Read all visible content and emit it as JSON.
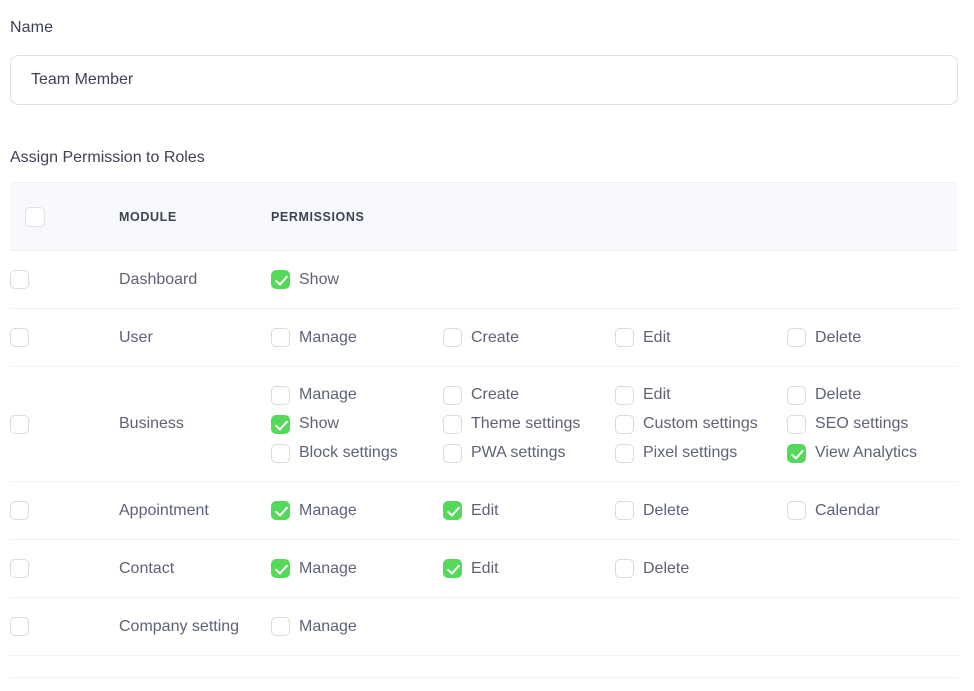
{
  "form": {
    "name_label": "Name",
    "name_value": "Team Member",
    "name_placeholder": "Name",
    "section_label": "Assign Permission to Roles"
  },
  "table": {
    "headers": {
      "select_all": "",
      "module": "MODULE",
      "permissions": "PERMISSIONS"
    },
    "select_all_checked": false,
    "rows": [
      {
        "module": "Dashboard",
        "row_checked": false,
        "permissions": [
          {
            "label": "Show",
            "checked": true
          }
        ]
      },
      {
        "module": "User",
        "row_checked": false,
        "permissions": [
          {
            "label": "Manage",
            "checked": false
          },
          {
            "label": "Create",
            "checked": false
          },
          {
            "label": "Edit",
            "checked": false
          },
          {
            "label": "Delete",
            "checked": false
          }
        ]
      },
      {
        "module": "Business",
        "row_checked": false,
        "permissions": [
          {
            "label": "Manage",
            "checked": false
          },
          {
            "label": "Create",
            "checked": false
          },
          {
            "label": "Edit",
            "checked": false
          },
          {
            "label": "Delete",
            "checked": false
          },
          {
            "label": "Show",
            "checked": true
          },
          {
            "label": "Theme settings",
            "checked": false
          },
          {
            "label": "Custom settings",
            "checked": false
          },
          {
            "label": "SEO settings",
            "checked": false
          },
          {
            "label": "Block settings",
            "checked": false
          },
          {
            "label": "PWA settings",
            "checked": false
          },
          {
            "label": "Pixel settings",
            "checked": false
          },
          {
            "label": "View Analytics",
            "checked": true
          }
        ]
      },
      {
        "module": "Appointment",
        "row_checked": false,
        "permissions": [
          {
            "label": "Manage",
            "checked": true
          },
          {
            "label": "Edit",
            "checked": true
          },
          {
            "label": "Delete",
            "checked": false
          },
          {
            "label": "Calendar",
            "checked": false
          }
        ]
      },
      {
        "module": "Contact",
        "row_checked": false,
        "permissions": [
          {
            "label": "Manage",
            "checked": true
          },
          {
            "label": "Edit",
            "checked": true
          },
          {
            "label": "Delete",
            "checked": false
          }
        ]
      },
      {
        "module": "Company setting",
        "row_checked": false,
        "permissions": [
          {
            "label": "Manage",
            "checked": false
          }
        ]
      }
    ]
  },
  "colors": {
    "checked_green": "#55d95a",
    "border": "#eff2f5",
    "header_bg": "#f8f9fc",
    "text": "#5e6278"
  }
}
